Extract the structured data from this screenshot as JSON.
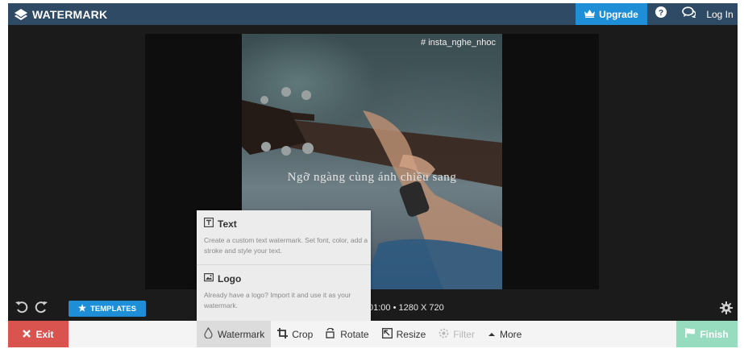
{
  "header": {
    "brand": "WATERMARK",
    "upgrade_label": "Upgrade",
    "login_label": "Log In"
  },
  "canvas": {
    "watermark_top_text": "# insta_nghe_nhoc",
    "watermark_center_text": "Ngỡ ngàng cùng ánh chiều sang",
    "file_info": "01:00 • 1280 X 720"
  },
  "controls": {
    "templates_label": "TEMPLATES"
  },
  "watermark_menu": {
    "items": [
      {
        "title": "Text",
        "description": "Create a custom text watermark. Set font, color, add a stroke and style your text."
      },
      {
        "title": "Logo",
        "description": "Already have a logo? Import it and use it as your watermark."
      }
    ]
  },
  "toolbar": {
    "exit_label": "Exit",
    "tools": [
      {
        "label": "Watermark",
        "icon": "watermark-icon",
        "state": "active"
      },
      {
        "label": "Crop",
        "icon": "crop-icon",
        "state": "normal"
      },
      {
        "label": "Rotate",
        "icon": "rotate-icon",
        "state": "normal"
      },
      {
        "label": "Resize",
        "icon": "resize-icon",
        "state": "normal"
      },
      {
        "label": "Filter",
        "icon": "filter-icon",
        "state": "disabled"
      },
      {
        "label": "More",
        "icon": "caret-up-icon",
        "state": "normal"
      }
    ],
    "finish_label": "Finish"
  },
  "colors": {
    "header_bg": "#2e4a64",
    "accent_blue": "#1e8fd6",
    "exit_red": "#d9534f",
    "finish_green": "#98dcc0",
    "app_bg": "#1b1b1b"
  }
}
